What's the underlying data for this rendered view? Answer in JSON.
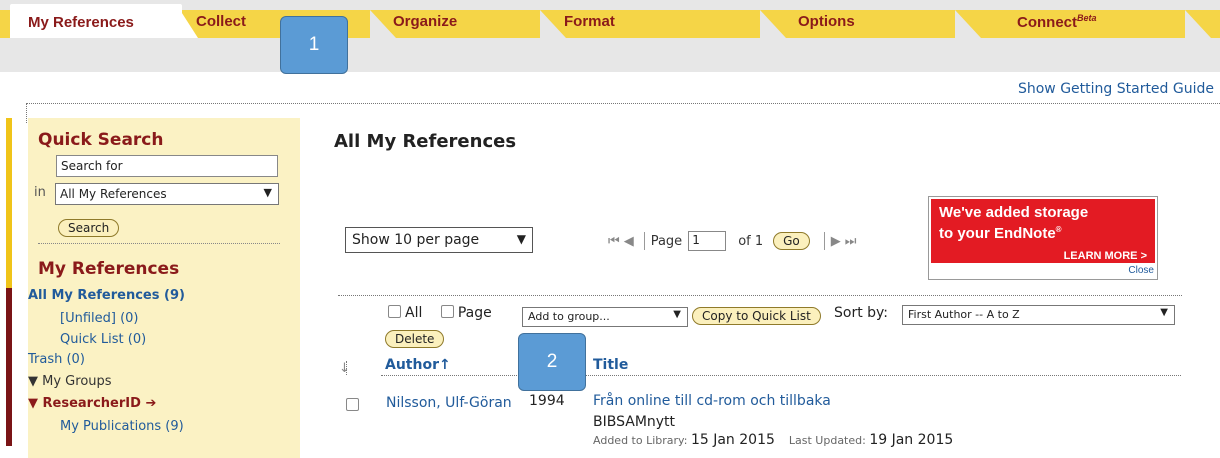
{
  "tabs": [
    {
      "label": "My References",
      "active": true
    },
    {
      "label": "Collect"
    },
    {
      "label": "Organize"
    },
    {
      "label": "Format"
    },
    {
      "label": "Options"
    },
    {
      "label": "Connect",
      "sup": "Beta"
    }
  ],
  "header": {
    "guide_link": "Show Getting Started Guide"
  },
  "quick_search": {
    "title": "Quick Search",
    "input_value": "Search for",
    "in_label": "in",
    "scope_value": "All My References",
    "search_button": "Search"
  },
  "my_references": {
    "title": "My References",
    "all": "All My References (9)",
    "unfiled": "[Unfiled] (0)",
    "quick_list": "Quick List (0)",
    "trash": "Trash (0)",
    "my_groups": "My Groups",
    "researcherid": "ResearcherID",
    "my_publications": "My Publications  (9)"
  },
  "main": {
    "title": "All My References",
    "per_page": "Show 10 per page",
    "page_label": "Page",
    "page_value": "1",
    "of_label": "of 1",
    "go_button": "Go"
  },
  "ad": {
    "line1": "We've added storage",
    "line2": "to your EndNote",
    "reg": "®",
    "learn_more": "LEARN MORE  >",
    "close": "Close"
  },
  "controls": {
    "all_label": "All",
    "page_label": "Page",
    "group_select": "Add to group...",
    "copy_button": "Copy to Quick List",
    "sort_label": "Sort by:",
    "sort_value": "First Author -- A to Z",
    "delete_button": "Delete"
  },
  "columns": {
    "author": "Author",
    "title": "Title"
  },
  "records": [
    {
      "author": "Nilsson, Ulf-Göran",
      "year": "1994",
      "title": "Från online till cd-rom och tillbaka",
      "source": "BIBSAMnytt",
      "added_label": "Added to Library:",
      "added_date": "15 Jan 2015",
      "updated_label": "Last Updated:",
      "updated_date": "19 Jan 2015"
    }
  ],
  "callouts": {
    "one": "1",
    "two": "2"
  },
  "colors": {
    "tab_yellow": "#f5d547",
    "maroon": "#8a1a1a",
    "link_blue": "#215b9b",
    "ad_red": "#e31b23",
    "callout_blue": "#5b9bd5"
  }
}
